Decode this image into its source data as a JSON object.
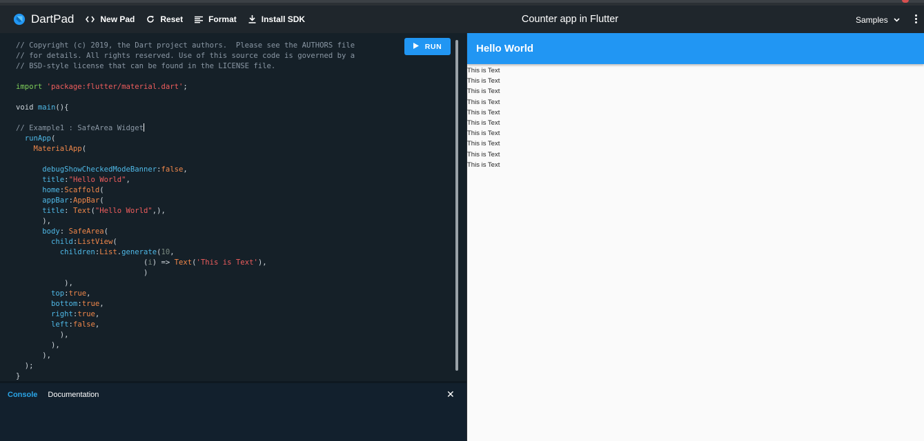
{
  "header": {
    "app_name": "DartPad",
    "tools": [
      {
        "label": "New Pad",
        "icon": "code-brackets-icon"
      },
      {
        "label": "Reset",
        "icon": "refresh-icon"
      },
      {
        "label": "Format",
        "icon": "format-lines-icon"
      },
      {
        "label": "Install SDK",
        "icon": "download-icon"
      }
    ],
    "title": "Counter app in Flutter",
    "samples_label": "Samples"
  },
  "editor": {
    "run_label": "RUN",
    "lines": [
      [
        {
          "t": "// Copyright (c) 2019, the Dart project authors.  Please see the AUTHORS file",
          "c": "com"
        }
      ],
      [
        {
          "t": "// for details. All rights reserved. Use of this source code is governed by a",
          "c": "com"
        }
      ],
      [
        {
          "t": "// BSD-style license that can be found in the LICENSE file.",
          "c": "com"
        }
      ],
      [],
      [
        {
          "t": "import ",
          "c": "imp"
        },
        {
          "t": "'package:flutter/material.dart'",
          "c": "str"
        },
        {
          "t": ";",
          "c": "pl"
        }
      ],
      [],
      [
        {
          "t": "void ",
          "c": "pl"
        },
        {
          "t": "main",
          "c": "fn"
        },
        {
          "t": "(){",
          "c": "pl"
        }
      ],
      [],
      [
        {
          "t": "// Example1 : SafeArea Widget",
          "c": "com"
        }
      ],
      [
        {
          "t": "  ",
          "c": "pl"
        },
        {
          "t": "runApp",
          "c": "fn"
        },
        {
          "t": "(",
          "c": "pl"
        }
      ],
      [
        {
          "t": "    ",
          "c": "pl"
        },
        {
          "t": "MaterialApp",
          "c": "cls"
        },
        {
          "t": "(",
          "c": "pl"
        }
      ],
      [],
      [
        {
          "t": "      ",
          "c": "pl"
        },
        {
          "t": "debugShowCheckedModeBanner",
          "c": "fn"
        },
        {
          "t": ":",
          "c": "pl"
        },
        {
          "t": "false",
          "c": "kw"
        },
        {
          "t": ",",
          "c": "pl"
        }
      ],
      [
        {
          "t": "      ",
          "c": "pl"
        },
        {
          "t": "title",
          "c": "fn"
        },
        {
          "t": ":",
          "c": "pl"
        },
        {
          "t": "\"Hello World\"",
          "c": "str"
        },
        {
          "t": ",",
          "c": "pl"
        }
      ],
      [
        {
          "t": "      ",
          "c": "pl"
        },
        {
          "t": "home",
          "c": "fn"
        },
        {
          "t": ":",
          "c": "pl"
        },
        {
          "t": "Scaffold",
          "c": "cls"
        },
        {
          "t": "(",
          "c": "pl"
        }
      ],
      [
        {
          "t": "      ",
          "c": "pl"
        },
        {
          "t": "appBar",
          "c": "fn"
        },
        {
          "t": ":",
          "c": "pl"
        },
        {
          "t": "AppBar",
          "c": "cls"
        },
        {
          "t": "(",
          "c": "pl"
        }
      ],
      [
        {
          "t": "      ",
          "c": "pl"
        },
        {
          "t": "title",
          "c": "fn"
        },
        {
          "t": ": ",
          "c": "pl"
        },
        {
          "t": "Text",
          "c": "cls"
        },
        {
          "t": "(",
          "c": "pl"
        },
        {
          "t": "\"Hello World\"",
          "c": "str"
        },
        {
          "t": ",),",
          "c": "pl"
        }
      ],
      [
        {
          "t": "      ),",
          "c": "pl"
        }
      ],
      [
        {
          "t": "      ",
          "c": "pl"
        },
        {
          "t": "body",
          "c": "fn"
        },
        {
          "t": ": ",
          "c": "pl"
        },
        {
          "t": "SafeArea",
          "c": "cls"
        },
        {
          "t": "(",
          "c": "pl"
        }
      ],
      [
        {
          "t": "        ",
          "c": "pl"
        },
        {
          "t": "child",
          "c": "fn"
        },
        {
          "t": ":",
          "c": "pl"
        },
        {
          "t": "ListView",
          "c": "cls"
        },
        {
          "t": "(",
          "c": "pl"
        }
      ],
      [
        {
          "t": "          ",
          "c": "pl"
        },
        {
          "t": "children",
          "c": "fn"
        },
        {
          "t": ":",
          "c": "pl"
        },
        {
          "t": "List",
          "c": "cls"
        },
        {
          "t": ".",
          "c": "pl"
        },
        {
          "t": "generate",
          "c": "fn"
        },
        {
          "t": "(",
          "c": "pl"
        },
        {
          "t": "10",
          "c": "num"
        },
        {
          "t": ",",
          "c": "pl"
        }
      ],
      [
        {
          "t": "                             (",
          "c": "pl"
        },
        {
          "t": "i",
          "c": "num"
        },
        {
          "t": ") => ",
          "c": "pl"
        },
        {
          "t": "Text",
          "c": "cls"
        },
        {
          "t": "(",
          "c": "pl"
        },
        {
          "t": "'This is Text'",
          "c": "str"
        },
        {
          "t": "),",
          "c": "pl"
        }
      ],
      [
        {
          "t": "                             )",
          "c": "pl"
        }
      ],
      [
        {
          "t": "           ),",
          "c": "pl"
        }
      ],
      [
        {
          "t": "        ",
          "c": "pl"
        },
        {
          "t": "top",
          "c": "fn"
        },
        {
          "t": ":",
          "c": "pl"
        },
        {
          "t": "true",
          "c": "kw"
        },
        {
          "t": ",",
          "c": "pl"
        }
      ],
      [
        {
          "t": "        ",
          "c": "pl"
        },
        {
          "t": "bottom",
          "c": "fn"
        },
        {
          "t": ":",
          "c": "pl"
        },
        {
          "t": "true",
          "c": "kw"
        },
        {
          "t": ",",
          "c": "pl"
        }
      ],
      [
        {
          "t": "        ",
          "c": "pl"
        },
        {
          "t": "right",
          "c": "fn"
        },
        {
          "t": ":",
          "c": "pl"
        },
        {
          "t": "true",
          "c": "kw"
        },
        {
          "t": ",",
          "c": "pl"
        }
      ],
      [
        {
          "t": "        ",
          "c": "pl"
        },
        {
          "t": "left",
          "c": "fn"
        },
        {
          "t": ":",
          "c": "pl"
        },
        {
          "t": "false",
          "c": "kw"
        },
        {
          "t": ",",
          "c": "pl"
        }
      ],
      [
        {
          "t": "          ),",
          "c": "pl"
        }
      ],
      [
        {
          "t": "        ),",
          "c": "pl"
        }
      ],
      [
        {
          "t": "      ),",
          "c": "pl"
        }
      ],
      [
        {
          "t": "  );",
          "c": "pl"
        }
      ],
      [
        {
          "t": "}",
          "c": "pl"
        }
      ]
    ],
    "cursor_line": 8
  },
  "console": {
    "tab_console": "Console",
    "tab_docs": "Documentation",
    "close_glyph": "✕"
  },
  "output": {
    "appbar_title": "Hello World",
    "items": [
      "This is Text",
      "This is Text",
      "This is Text",
      "This is Text",
      "This is Text",
      "This is Text",
      "This is Text",
      "This is Text",
      "This is Text",
      "This is Text"
    ]
  },
  "colors": {
    "accent": "#2196f3",
    "editor_bg": "#152028",
    "header_bg": "#1f262c"
  }
}
